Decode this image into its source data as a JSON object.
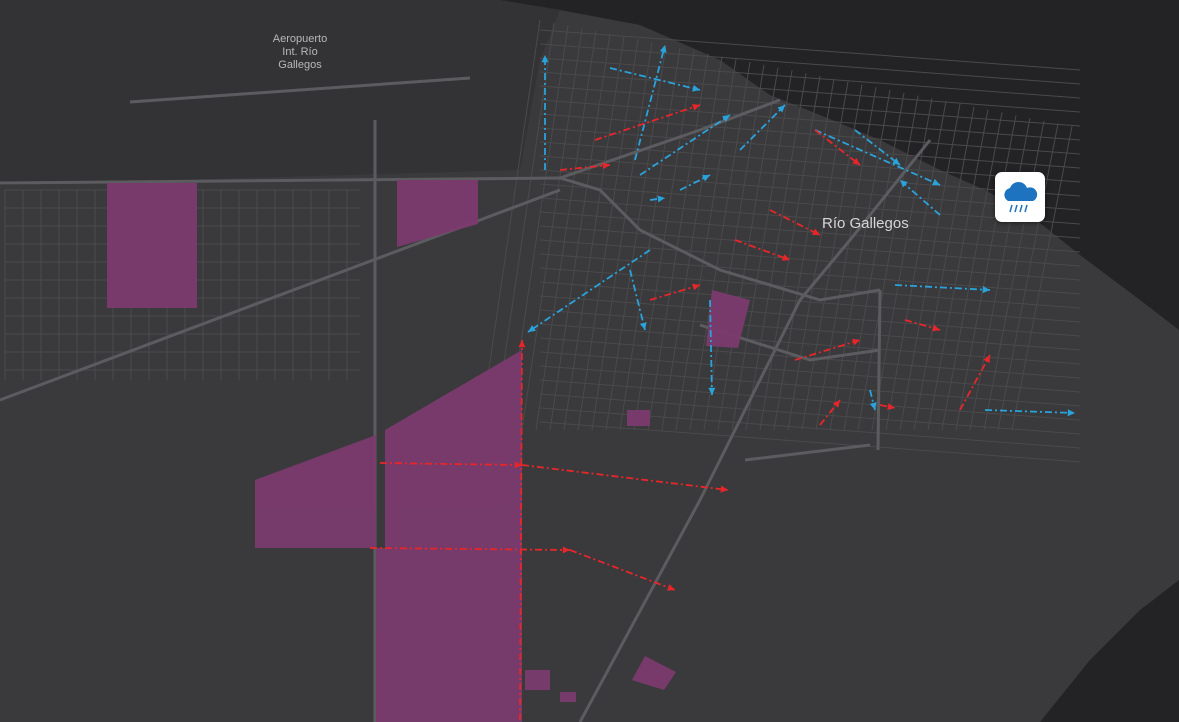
{
  "map": {
    "airport_label": [
      "Aeropuerto",
      "Int. Río",
      "Gallegos"
    ],
    "city_label": "Río Gallegos",
    "weather_icon": "rain-cloud-icon",
    "colors": {
      "land": "#3a3a3c",
      "water": "#232326",
      "roads": "#5a5a5d",
      "highlighted_zones": "#7a3a6e",
      "flow_red": "#e8262a",
      "flow_blue": "#2aa3dc"
    }
  }
}
